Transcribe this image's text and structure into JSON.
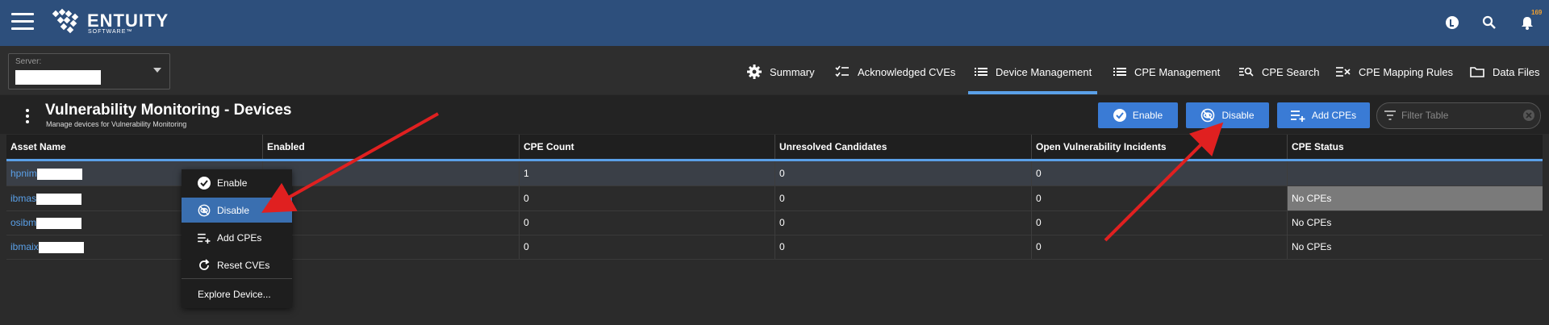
{
  "app": {
    "brand": "ENTUITY",
    "brand_sub": "SOFTWARE™",
    "notification_count": "169"
  },
  "server": {
    "label": "Server:"
  },
  "tabs": [
    {
      "label": "Summary",
      "icon": "gear-icon"
    },
    {
      "label": "Acknowledged CVEs",
      "icon": "checklist-icon"
    },
    {
      "label": "Device Management",
      "icon": "list-icon",
      "active": true
    },
    {
      "label": "CPE Management",
      "icon": "list-icon"
    },
    {
      "label": "CPE Search",
      "icon": "search-list-icon"
    },
    {
      "label": "CPE Mapping Rules",
      "icon": "mapping-icon"
    },
    {
      "label": "Data Files",
      "icon": "folder-icon"
    }
  ],
  "panel": {
    "title": "Vulnerability Monitoring - Devices",
    "subtitle": "Manage devices for Vulnerability Monitoring"
  },
  "actions": {
    "enable": "Enable",
    "disable": "Disable",
    "add_cpes": "Add CPEs",
    "filter_placeholder": "Filter Table"
  },
  "table": {
    "columns": [
      "Asset Name",
      "Enabled",
      "CPE Count",
      "Unresolved Candidates",
      "Open Vulnerability Incidents",
      "CPE Status"
    ],
    "rows": [
      {
        "asset": "hpnim",
        "enabled": "",
        "cpe_count": "1",
        "unresolved": "0",
        "open_incidents": "0",
        "status": ""
      },
      {
        "asset": "ibmas",
        "enabled": "",
        "cpe_count": "0",
        "unresolved": "0",
        "open_incidents": "0",
        "status": "No CPEs"
      },
      {
        "asset": "osibm",
        "enabled": "",
        "cpe_count": "0",
        "unresolved": "0",
        "open_incidents": "0",
        "status": "No CPEs"
      },
      {
        "asset": "ibmaix",
        "enabled": "",
        "cpe_count": "0",
        "unresolved": "0",
        "open_incidents": "0",
        "status": "No CPEs"
      }
    ]
  },
  "context_menu": {
    "items": [
      {
        "label": "Enable",
        "icon": "check-circle-icon"
      },
      {
        "label": "Disable",
        "icon": "eye-off-icon",
        "highlighted": true
      },
      {
        "label": "Add CPEs",
        "icon": "playlist-add-icon"
      },
      {
        "label": "Reset CVEs",
        "icon": "refresh-icon"
      },
      {
        "label": "Explore Device...",
        "icon": ""
      }
    ]
  },
  "colors": {
    "topbar": "#2d4f7c",
    "accent": "#3a7bd5",
    "link": "#5aa0e8",
    "annotation_arrow": "#e02020"
  }
}
